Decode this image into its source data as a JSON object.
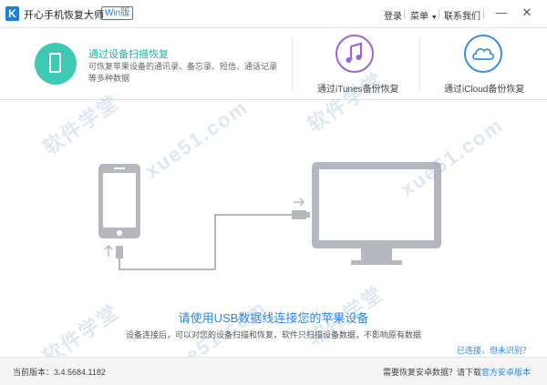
{
  "titlebar": {
    "logo_letter": "K",
    "app_title": "开心手机恢复大师",
    "version_badge": "Win版",
    "login": "登录",
    "menu": "菜单",
    "contact": "联系我们",
    "minimize_glyph": "—",
    "close_glyph": "✕"
  },
  "modes": [
    {
      "title": "通过设备扫描恢复",
      "desc": "可恢复苹果设备的通讯录、备忘录、短信、通话记录等多种数据"
    },
    {
      "label": "通过iTunes备份恢复"
    },
    {
      "label": "通过iCloud备份恢复"
    }
  ],
  "main": {
    "hint_title": "请使用USB数据线连接您的苹果设备",
    "hint_desc": "设备连接后，可以对您的设备扫描和恢复，软件只扫描设备数据，不影响原有数据",
    "connected_link": "已连接，但未识别？"
  },
  "footer": {
    "version_label": "当前版本：3.4.5684.1182",
    "android_prompt": "需要恢复安卓数据？请下载",
    "android_link": "官方安卓版本"
  },
  "watermark": {
    "text_cn": "软件学堂",
    "text_url": "xue51.com"
  },
  "colors": {
    "accent_teal": "#3ec9b4",
    "accent_blue": "#2d87e0",
    "itunes_purple": "#9b63d9",
    "icloud_blue": "#3a8fe0"
  }
}
